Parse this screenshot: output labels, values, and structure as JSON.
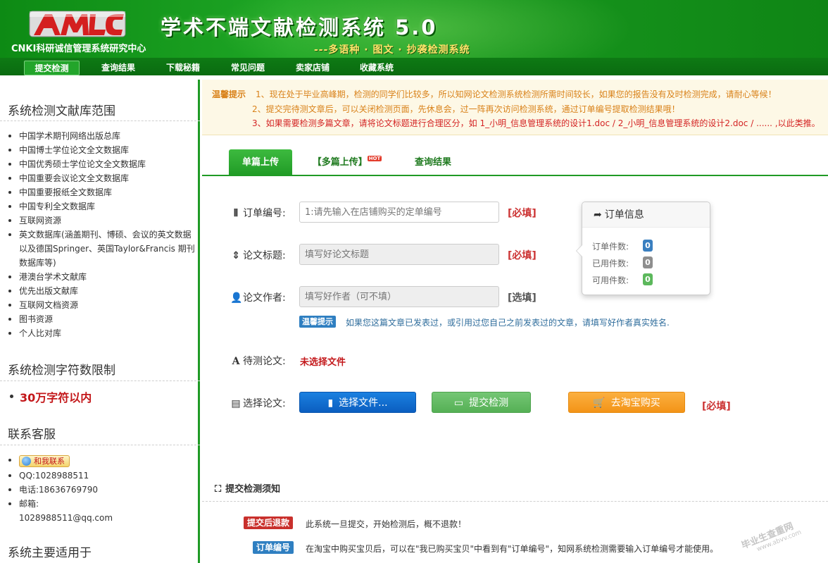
{
  "header": {
    "org": "CNKI科研诚信管理系统研究中心",
    "title": "学术不端文献检测系统 5.0",
    "subtitle": "---多语种 · 图文 · 抄袭检测系统"
  },
  "nav": {
    "items": [
      "提交检测",
      "查询结果",
      "下载秘籍",
      "常见问题",
      "卖家店铺",
      "收藏系统"
    ]
  },
  "sidebar": {
    "db_title": "系统检测文献库范围",
    "db_items": [
      "中国学术期刊网络出版总库",
      "中国博士学位论文全文数据库",
      "中国优秀硕士学位论文全文数据库",
      "中国重要会议论文全文数据库",
      "中国重要报纸全文数据库",
      "中国专利全文数据库",
      "互联网资源",
      "英文数据库(涵盖期刊、博硕、会议的英文数据",
      "以及德国Springer、英国Taylor&Francis 期刊",
      "数据库等)",
      "港澳台学术文献库",
      "优先出版文献库",
      "互联网文档资源",
      "图书资源",
      "个人比对库"
    ],
    "limit_title": "系统检测字符数限制",
    "limit_value": "30万字符以内",
    "contact_title": "联系客服",
    "contact_button": "和我联系",
    "qq": "QQ:1028988511",
    "phone": "电话:18636769790",
    "email_label": "邮箱:",
    "email": "1028988511@qq.com",
    "usage_title": "系统主要适用于"
  },
  "notice": {
    "label": "温馨提示",
    "line1": "1、现在处于毕业高峰期，检测的同学们比较多，所以知网论文检测系统检测所需时间较长，如果您的报告没有及时检测完成，请耐心等候！",
    "line2": "2、提交完待测文章后，可以关闭检测页面，先休息会，过一阵再次访问检测系统，通过订单编号提取检测结果哦！",
    "line3": "3、如果需要检测多篇文章，请将论文标题进行合理区分，如 1_小明_信息管理系统的设计1.doc / 2_小明_信息管理系统的设计2.doc / ...... ,以此类推。"
  },
  "tabs": {
    "single": "单篇上传",
    "multi": "【多篇上传】",
    "hot": "HOT",
    "query": "查询结果"
  },
  "form": {
    "order_label": "订单编号:",
    "order_placeholder": "1:请先输入在店铺购买的定单编号",
    "title_label": "论文标题:",
    "title_placeholder": "填写好论文标题",
    "author_label": "论文作者:",
    "author_placeholder": "填写好作者（可不填）",
    "required": "[必填]",
    "optional": "[选填]",
    "tip_badge": "温馨提示",
    "tip_text": "如果您这篇文章已发表过，或引用过您自己之前发表过的文章，请填写好作者真实姓名.",
    "pending_label": "待测论文:",
    "no_file": "未选择文件",
    "select_label": "选择论文:",
    "select_button": "选择文件...",
    "submit_button": "提交检测",
    "taobao_button": "去淘宝购买"
  },
  "order_info": {
    "title": "订单信息",
    "rows": [
      {
        "label": "订单件数:",
        "value": "0",
        "color": "#3a7fc0"
      },
      {
        "label": "已用件数:",
        "value": "0",
        "color": "#8e8e8e"
      },
      {
        "label": "可用件数:",
        "value": "0",
        "color": "#5cb85c"
      }
    ]
  },
  "rules": {
    "title": "提交检测须知",
    "items": [
      {
        "badge": "提交后退款",
        "text": "此系统一旦提交，开始检测后，概不退款！",
        "color": "#c9302c"
      },
      {
        "badge": "订单编号",
        "text": "在淘宝中购买宝贝后，可以在\"我已购买宝贝\"中看到有\"订单编号\"，知网系统检测需要输入订单编号才能使用。",
        "color": "#2f7fc1"
      }
    ]
  },
  "watermark": {
    "main": "毕业生查重网",
    "url": "www.abvv.com"
  }
}
